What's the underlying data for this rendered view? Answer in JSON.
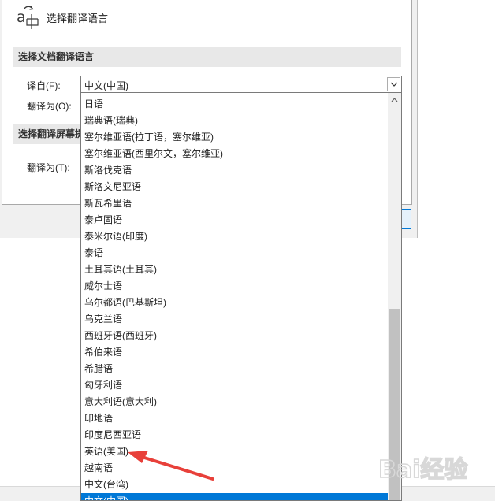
{
  "header": {
    "title": "选择翻译语言"
  },
  "document_section": {
    "heading": "选择文档翻译语言",
    "from_label": "译自(F):",
    "to_label": "翻译为(O):",
    "from_value": "中文(中国)"
  },
  "screen_section": {
    "heading": "选择翻译屏幕提",
    "to_label": "翻译为(T):"
  },
  "dropdown": {
    "items": [
      "日语",
      "瑞典语(瑞典)",
      "塞尔维亚语(拉丁语，塞尔维亚)",
      "塞尔维亚语(西里尔文，塞尔维亚)",
      "斯洛伐克语",
      "斯洛文尼亚语",
      "斯瓦希里语",
      "泰卢固语",
      "泰米尔语(印度)",
      "泰语",
      "土耳其语(土耳其)",
      "威尔士语",
      "乌尔都语(巴基斯坦)",
      "乌克兰语",
      "西班牙语(西班牙)",
      "希伯来语",
      "希腊语",
      "匈牙利语",
      "意大利语(意大利)",
      "印地语",
      "印度尼西亚语",
      "英语(美国)",
      "越南语",
      "中文(台湾)",
      "中文(中国)"
    ],
    "selected_index": 24
  },
  "watermark": {
    "text": "Bai经验"
  },
  "colors": {
    "selection": "#0078d7",
    "section_bg": "#e8e8e8",
    "annotation_arrow": "#e8403a"
  }
}
